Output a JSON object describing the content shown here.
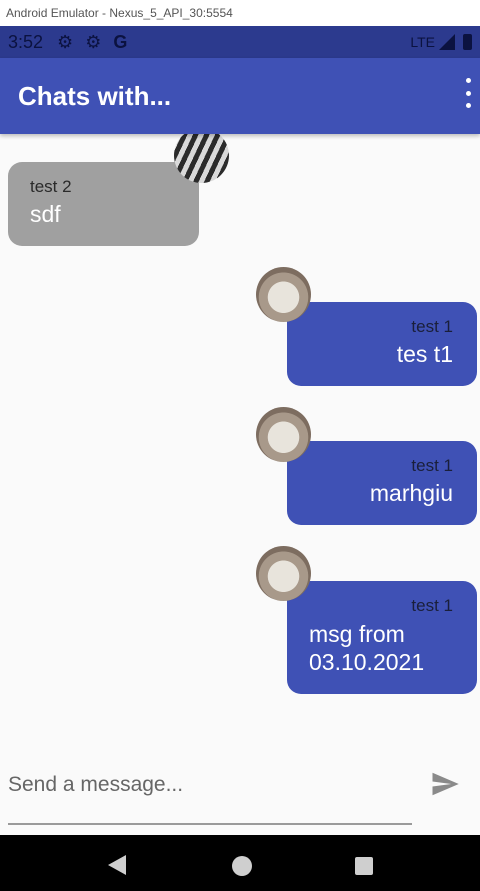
{
  "window": {
    "title": "Android Emulator - Nexus_5_API_30:5554"
  },
  "status_bar": {
    "time": "3:52",
    "network": "LTE",
    "icons": [
      "gear-icon",
      "gear-icon",
      "google-icon",
      "signal-icon",
      "battery-icon"
    ]
  },
  "app_bar": {
    "title": "Chats with...",
    "menu_icon": "overflow-menu-icon",
    "color": "#3f51b5"
  },
  "messages": [
    {
      "sender": "test 2",
      "text": "sdf",
      "direction": "incoming",
      "avatar": "zebra"
    },
    {
      "sender": "test 1",
      "text": "tes t1",
      "direction": "outgoing",
      "avatar": "dog"
    },
    {
      "sender": "test 1",
      "text": "marhgiu",
      "direction": "outgoing",
      "avatar": "dog"
    },
    {
      "sender": "test 1",
      "text": "msg from 03.10.2021",
      "direction": "outgoing",
      "avatar": "dog"
    }
  ],
  "composer": {
    "placeholder": "Send a message...",
    "value": "",
    "send_icon": "send-icon"
  },
  "colors": {
    "outgoing_bubble": "#3f51b5",
    "incoming_bubble": "#a0a0a0",
    "status_bar": "#2c3a8e"
  }
}
